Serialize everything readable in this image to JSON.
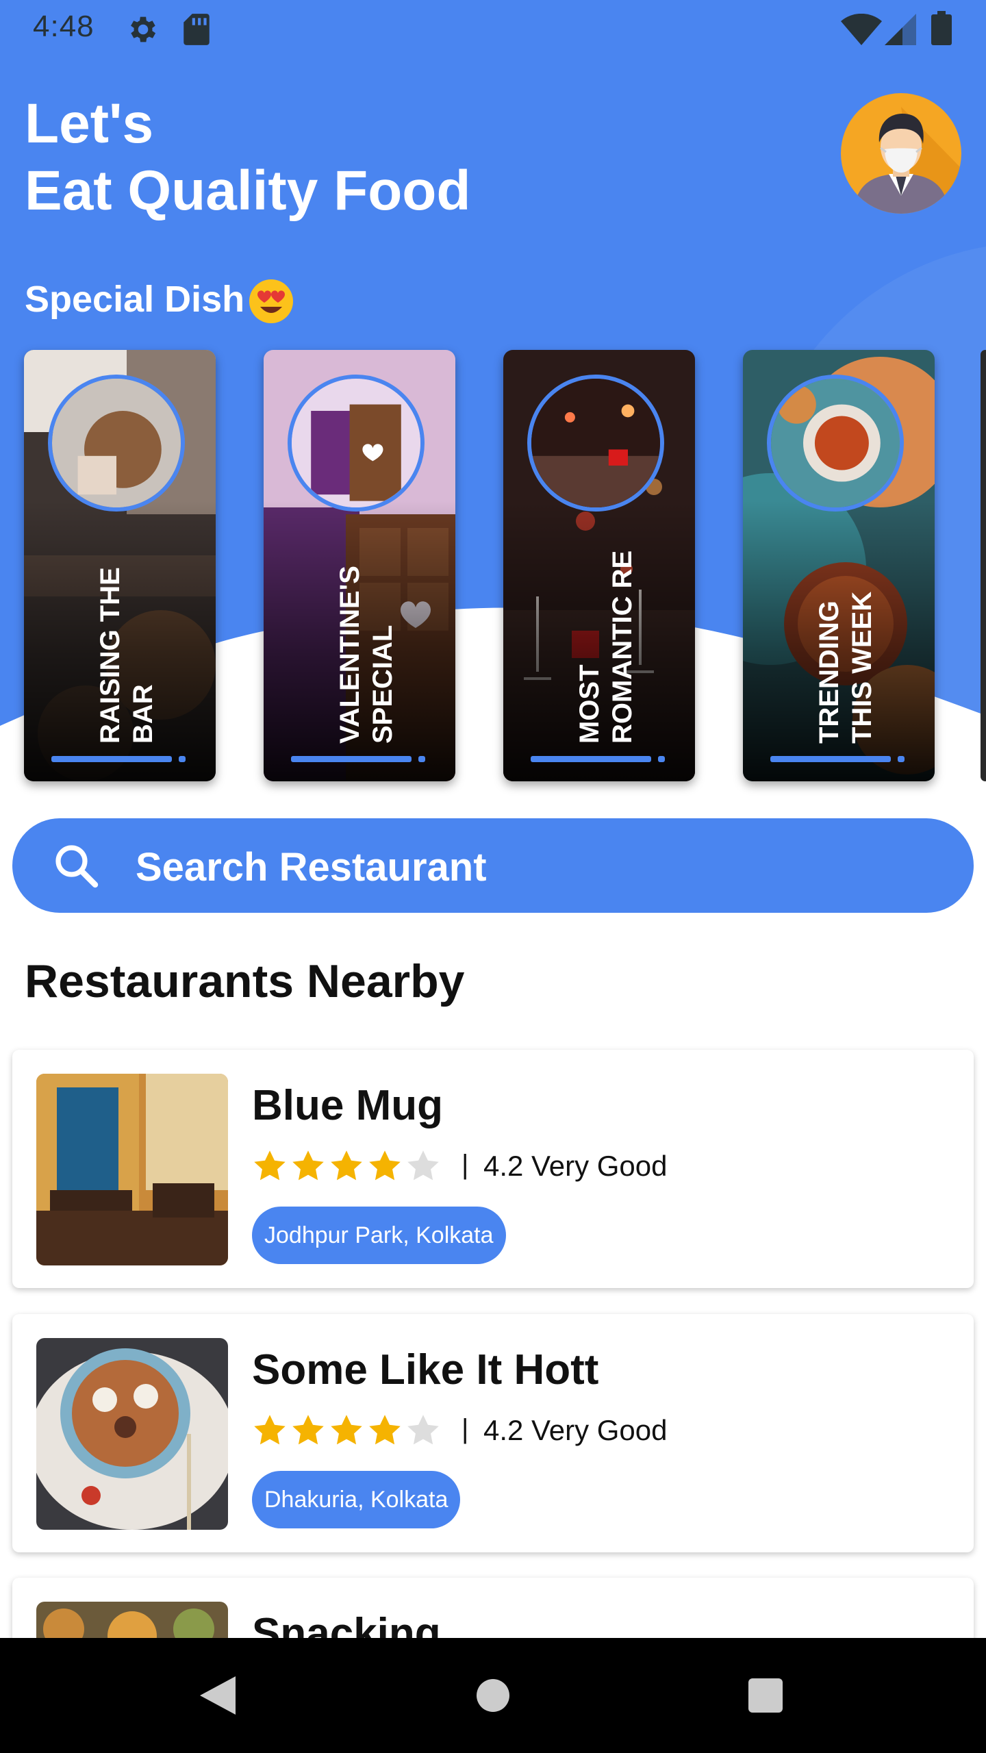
{
  "status_bar": {
    "time": "4:48",
    "icons": [
      "settings-icon",
      "sd-card-icon",
      "wifi-icon",
      "cell-signal-icon",
      "battery-icon"
    ]
  },
  "header": {
    "title_line1": "Let's",
    "title_line2": "Eat Quality Food",
    "avatar": "avatar-masked-man"
  },
  "special": {
    "label": "Special Dish",
    "emoji": "heart-eyes-emoji",
    "stories": [
      {
        "line1": "Raising the",
        "line2": "Bar"
      },
      {
        "line1": "Valentine's",
        "line2": "Special"
      },
      {
        "line1": "Most",
        "line2": "Romantic Re"
      },
      {
        "line1": "Trending",
        "line2": "this week"
      }
    ]
  },
  "search": {
    "label": "Search Restaurant",
    "icon": "search-icon"
  },
  "nearby": {
    "title": "Restaurants Nearby",
    "restaurants": [
      {
        "name": "Blue Mug",
        "rating": 4,
        "rating_text": "4.2 Very Good",
        "location": "Jodhpur Park, Kolkata"
      },
      {
        "name": "Some Like It Hott",
        "rating": 4,
        "rating_text": "4.2 Very Good",
        "location": "Dhakuria, Kolkata"
      },
      {
        "name": "Snacking"
      }
    ],
    "separator": "|"
  },
  "navbar": {
    "icons": [
      "back-icon",
      "home-icon",
      "recents-icon"
    ]
  },
  "colors": {
    "primary": "#4a85f0",
    "star": "#f5b301",
    "star_empty": "#dddddd",
    "nav": "#000000"
  }
}
